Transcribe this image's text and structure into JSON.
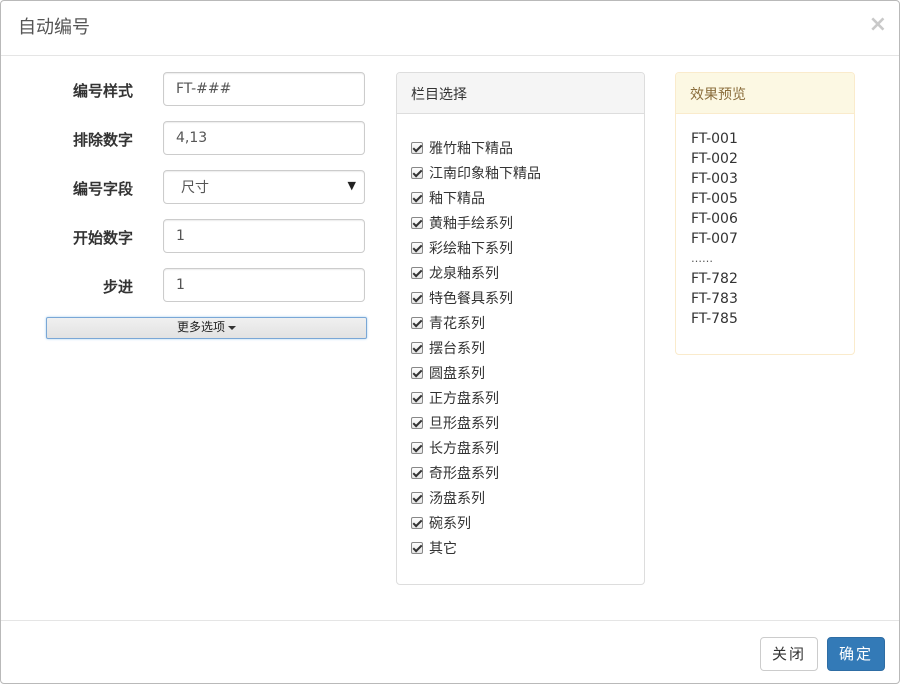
{
  "dialog": {
    "title": "自动编号",
    "close_symbol": "×"
  },
  "form": {
    "rows": [
      {
        "label": "编号样式",
        "value": "FT-###"
      },
      {
        "label": "排除数字",
        "value": "4,13"
      },
      {
        "label": "编号字段",
        "value": "尺寸"
      },
      {
        "label": "开始数字",
        "value": "1"
      },
      {
        "label": "步进",
        "value": "1"
      }
    ],
    "more_options_label": "更多选项"
  },
  "categories": {
    "heading": "栏目选择",
    "items": [
      {
        "label": "雅竹釉下精品",
        "checked": true
      },
      {
        "label": "江南印象釉下精品",
        "checked": true
      },
      {
        "label": "釉下精品",
        "checked": true
      },
      {
        "label": "黄釉手绘系列",
        "checked": true
      },
      {
        "label": "彩绘釉下系列",
        "checked": true
      },
      {
        "label": "龙泉釉系列",
        "checked": true
      },
      {
        "label": "特色餐具系列",
        "checked": true
      },
      {
        "label": "青花系列",
        "checked": true
      },
      {
        "label": "摆台系列",
        "checked": true
      },
      {
        "label": "圆盘系列",
        "checked": true
      },
      {
        "label": "正方盘系列",
        "checked": true
      },
      {
        "label": "旦形盘系列",
        "checked": true
      },
      {
        "label": "长方盘系列",
        "checked": true
      },
      {
        "label": "奇形盘系列",
        "checked": true
      },
      {
        "label": "汤盘系列",
        "checked": true
      },
      {
        "label": "碗系列",
        "checked": true
      },
      {
        "label": "其它",
        "checked": true
      }
    ]
  },
  "preview": {
    "heading": "效果预览",
    "items": [
      "FT-001",
      "FT-002",
      "FT-003",
      "FT-005",
      "FT-006",
      "FT-007",
      "……",
      "FT-782",
      "FT-783",
      "FT-785"
    ]
  },
  "footer": {
    "close_label": "关闭",
    "confirm_label": "确定"
  },
  "colors": {
    "primary": "#337ab7",
    "preview_heading_bg": "#fcf8e3",
    "preview_heading_text": "#8a6d3b"
  }
}
